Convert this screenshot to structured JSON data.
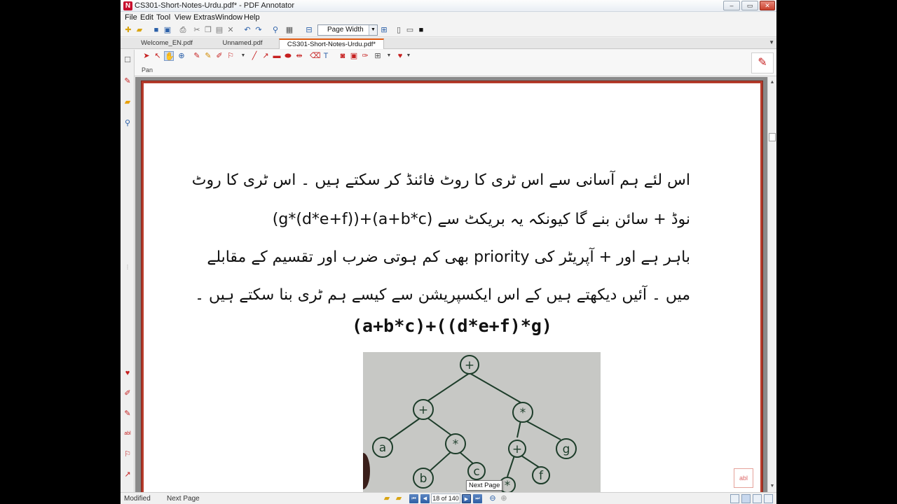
{
  "window": {
    "title": "CS301-Short-Notes-Urdu.pdf* - PDF Annotator",
    "minimize": "–",
    "maximize": "▭",
    "close": "✕"
  },
  "menu": [
    "File",
    "Edit",
    "Tool",
    "View",
    "Extras",
    "Window",
    "Help"
  ],
  "toolbar": {
    "zoom_value": "Page Width"
  },
  "tabs": [
    {
      "label": "Welcome_EN.pdf",
      "active": false
    },
    {
      "label": "Unnamed.pdf",
      "active": false
    },
    {
      "label": "CS301-Short-Notes-Urdu.pdf*",
      "active": true
    }
  ],
  "tools": {
    "current_tool_label": "Pan"
  },
  "document": {
    "urdu_lines": [
      "اس لئے ہم آسانی سے اس ٹری کا روٹ فائنڈ کر سکتے ہیں ۔ اس ٹری کا روٹ",
      "نوڈ + سائن بنے گا کیونکہ یہ بریکٹ سے (a+b*c)+((d*e+f)*g)",
      "باہر ہے اور + آپریٹر کی priority بھی کم ہوتی ضرب اور تقسیم کے مقابلے",
      "میں ۔ آئیں دیکھتے ہیں کے اس ایکسپریشن سے کیسے ہم ٹری بنا سکتے ہیں ۔"
    ],
    "expression": "(a+b*c)+((d*e+f)*g)",
    "tree_nodes": [
      "+",
      "+",
      "*",
      "a",
      "*",
      "+",
      "g",
      "b",
      "c",
      "*",
      "f"
    ],
    "note_marker": "abl"
  },
  "status": {
    "mode": "Modified",
    "action": "Next Page",
    "page_indicator": "18 of 140",
    "tooltip": "Next Page"
  }
}
